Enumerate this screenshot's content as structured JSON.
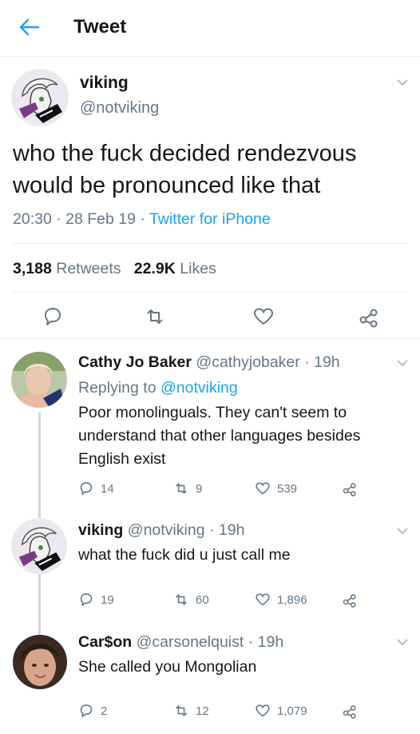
{
  "header": {
    "title": "Tweet"
  },
  "tweet": {
    "name": "viking",
    "handle": "@notviking",
    "text": "who the fuck decided rendezvous would be pronounced like that",
    "time": "20:30",
    "date": "28 Feb 19",
    "source": "Twitter for iPhone",
    "retweets_count": "3,188",
    "retweets_label": "Retweets",
    "likes_count": "22.9K",
    "likes_label": "Likes"
  },
  "replies": [
    {
      "name": "Cathy Jo Baker",
      "handle": "@cathyjobaker",
      "age": "19h",
      "replying_prefix": "Replying to",
      "replying_to": "@notviking",
      "text": "Poor monolinguals. They can't seem to understand that other languages besides English exist",
      "reply_count": "14",
      "retweet_count": "9",
      "like_count": "539"
    },
    {
      "name": "viking",
      "handle": "@notviking",
      "age": "19h",
      "text": "what the fuck did u just call me",
      "reply_count": "19",
      "retweet_count": "60",
      "like_count": "1,896"
    },
    {
      "name": "Car$on",
      "handle": "@carsonelquist",
      "age": "19h",
      "text": "She called you Mongolian",
      "reply_count": "2",
      "retweet_count": "12",
      "like_count": "1,079"
    }
  ],
  "icons": {
    "back": "arrow-left-icon",
    "caret": "chevron-down-icon",
    "reply": "speech-bubble-icon",
    "retweet": "retweet-arrows-icon",
    "like": "heart-icon",
    "share": "share-icon"
  },
  "colors": {
    "accent": "#1da1f2",
    "muted": "#657786",
    "text": "#14171a",
    "border": "#e6ecf0"
  }
}
